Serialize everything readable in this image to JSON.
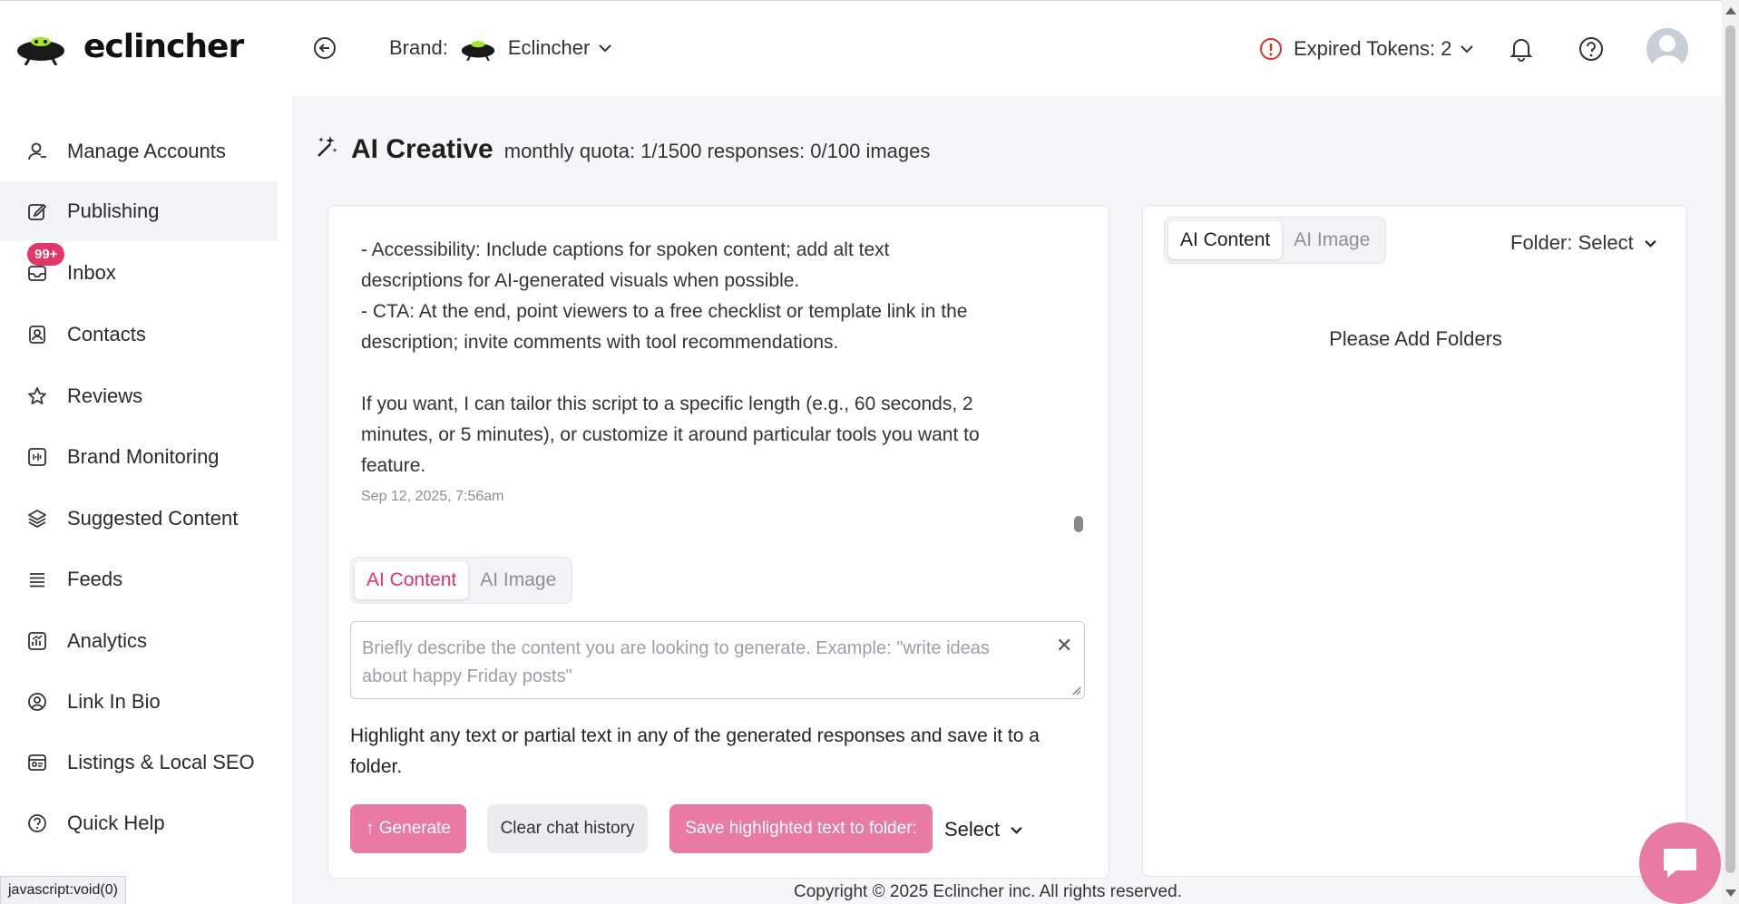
{
  "header": {
    "logo_text": "eclincher",
    "brand_label": "Brand:",
    "brand_name": "Eclincher",
    "expired_tokens": "Expired Tokens: 2"
  },
  "sidebar": {
    "items": [
      {
        "label": "Manage Accounts"
      },
      {
        "label": "Publishing"
      },
      {
        "label": "Inbox"
      },
      {
        "label": "Contacts"
      },
      {
        "label": "Reviews"
      },
      {
        "label": "Brand Monitoring"
      },
      {
        "label": "Suggested Content"
      },
      {
        "label": "Feeds"
      },
      {
        "label": "Analytics"
      },
      {
        "label": "Link In Bio"
      },
      {
        "label": "Listings & Local SEO"
      },
      {
        "label": "Quick Help"
      }
    ],
    "inbox_badge": "99+"
  },
  "main": {
    "title": "AI Creative",
    "quota": "monthly quota: 1/1500 responses: 0/100 images"
  },
  "chat": {
    "paragraph1": "- Accessibility: Include captions for spoken content; add alt text descriptions for AI-generated visuals when possible.\n- CTA: At the end, point viewers to a free checklist or template link in the description; invite comments with tool recommendations.",
    "paragraph2": "If you want, I can tailor this script to a specific length (e.g., 60 seconds, 2 minutes, or 5 minutes), or customize it around particular tools you want to feature.",
    "timestamp": "Sep 12, 2025, 7:56am",
    "tab_content": "AI Content",
    "tab_image": "AI Image",
    "prompt_placeholder": "Briefly describe the content you are looking to generate. Example: \"write ideas about happy Friday posts\"",
    "hint": "Highlight any text or partial text in any of the generated responses and save it to a folder.",
    "generate_label": "↑ Generate",
    "clear_label": "Clear chat history",
    "save_label": "Save highlighted text to folder:",
    "select_label": "Select"
  },
  "folders": {
    "tab_content": "AI Content",
    "tab_image": "AI Image",
    "folder_label": "Folder: Select",
    "empty_text": "Please Add Folders"
  },
  "footer": {
    "copyright": "Copyright © 2025 Eclincher inc. All rights reserved."
  },
  "status_bar": {
    "url": "javascript:void(0)"
  },
  "colors": {
    "accent": "#e4356b",
    "button_pink": "#e87aa4",
    "warning_red": "#d9342b"
  }
}
